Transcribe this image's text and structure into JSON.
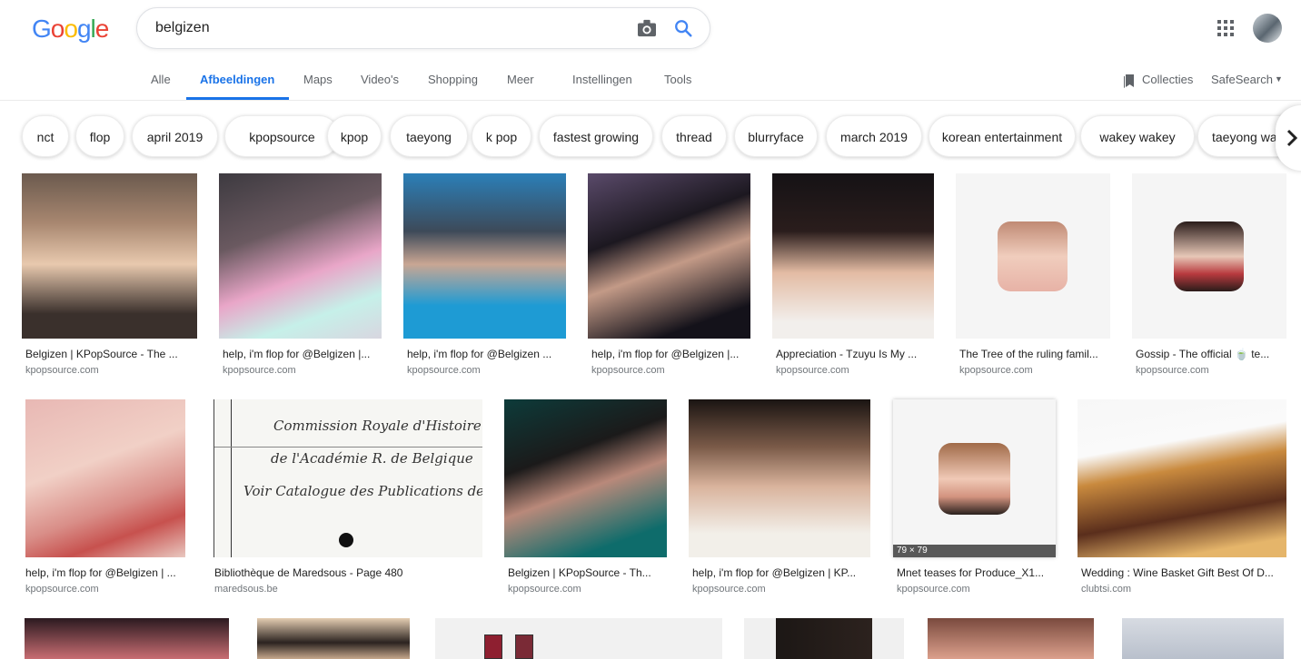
{
  "header": {
    "logo_letters": [
      "G",
      "o",
      "o",
      "g",
      "l",
      "e"
    ],
    "logo_colors": [
      "#4285f4",
      "#ea4335",
      "#fbbc05",
      "#4285f4",
      "#34a853",
      "#ea4335"
    ],
    "search_value": "belgizen",
    "icons": [
      "camera-icon",
      "search-icon",
      "apps-grid-icon",
      "avatar"
    ]
  },
  "nav": {
    "items": [
      "Alle",
      "Afbeeldingen",
      "Maps",
      "Video's",
      "Shopping",
      "Meer",
      "Instellingen",
      "Tools"
    ],
    "active": "Afbeeldingen",
    "collections": "Collecties",
    "safesearch": "SafeSearch"
  },
  "chips": [
    "nct",
    "flop",
    "april 2019",
    "kpopsource",
    "kpop",
    "taeyong",
    "k pop",
    "fastest growing",
    "thread",
    "blurryface",
    "march 2019",
    "korean entertainment",
    "wakey wakey",
    "taeyong wa"
  ],
  "row1": [
    {
      "caption": "Belgizen | KPopSource - The ...",
      "source": "kpopsource.com"
    },
    {
      "caption": "help, i'm flop for @Belgizen |...",
      "source": "kpopsource.com"
    },
    {
      "caption": "help, i'm flop for @Belgizen ...",
      "source": "kpopsource.com"
    },
    {
      "caption": "help, i'm flop for @Belgizen |...",
      "source": "kpopsource.com"
    },
    {
      "caption": "Appreciation - Tzuyu Is My ...",
      "source": "kpopsource.com"
    },
    {
      "caption": "The Tree of the ruling famil...",
      "source": "kpopsource.com"
    },
    {
      "caption": "Gossip - The official 🍵 te...",
      "source": "kpopsource.com"
    }
  ],
  "row2": [
    {
      "caption": "help, i'm flop for @Belgizen | ...",
      "source": "kpopsource.com"
    },
    {
      "caption": "Bibliothèque de Maredsous - Page 480",
      "source": "maredsous.be"
    },
    {
      "caption": "Belgizen | KPopSource - Th...",
      "source": "kpopsource.com"
    },
    {
      "caption": "help, i'm flop for @Belgizen | KP...",
      "source": "kpopsource.com"
    },
    {
      "caption": "Mnet teases for Produce_X1...",
      "source": "kpopsource.com",
      "dims": "79 × 79"
    },
    {
      "caption": "Wedding : Wine Basket Gift Best Of D...",
      "source": "clubtsi.com"
    }
  ],
  "handwriting": [
    "Commission Royale d'Histoire",
    "de l'Académie R. de Belgique",
    "Voir Catalogue des Publications de la ..."
  ],
  "colors": {
    "accent": "#1a73e8",
    "text_secondary": "#70757a"
  }
}
